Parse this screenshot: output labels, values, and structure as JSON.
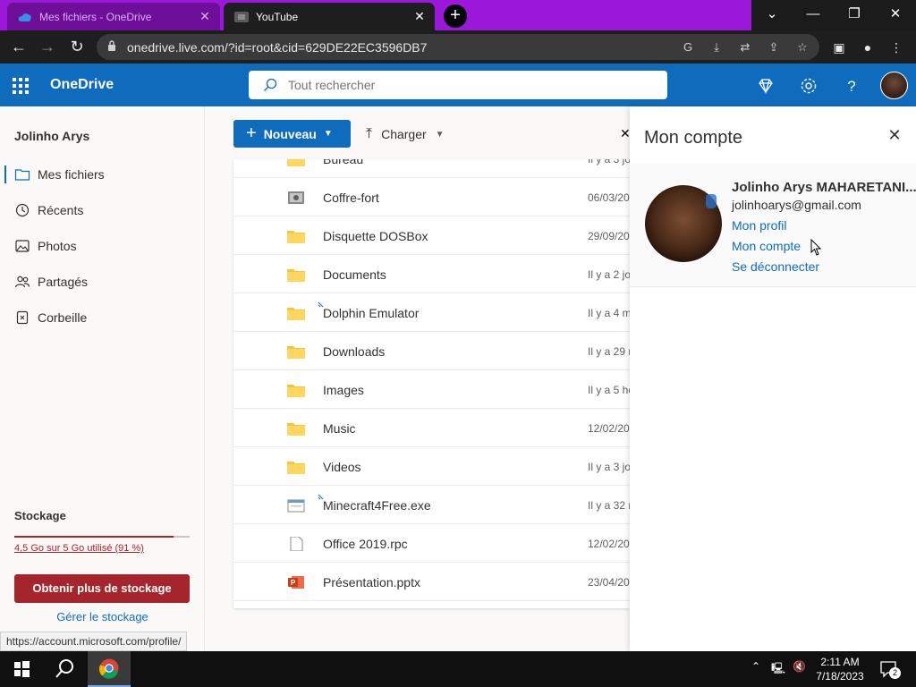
{
  "browser": {
    "tabs": [
      {
        "title": "Mes fichiers - OneDrive",
        "active": false
      },
      {
        "title": "YouTube",
        "active": true
      }
    ],
    "new_tab": "+",
    "url": "onedrive.live.com/?id=root&cid=629DE22EC3596DB7",
    "status_url": "https://account.microsoft.com/profile/"
  },
  "header": {
    "app_name": "OneDrive",
    "search_placeholder": "Tout rechercher"
  },
  "sidebar": {
    "user_name": "Jolinho Arys",
    "items": [
      {
        "label": "Mes fichiers",
        "icon": "folder-icon",
        "active": true
      },
      {
        "label": "Récents",
        "icon": "history-icon"
      },
      {
        "label": "Photos",
        "icon": "image-icon"
      },
      {
        "label": "Partagés",
        "icon": "people-icon"
      },
      {
        "label": "Corbeille",
        "icon": "trash-icon"
      }
    ],
    "storage": {
      "title": "Stockage",
      "usage_text": "4,5 Go sur 5 Go utilisé (91 %)",
      "usage_fraction": 0.91,
      "buy_button": "Obtenir plus de stockage",
      "manage_link": "Gérer le stockage"
    }
  },
  "commandbar": {
    "new_label": "Nouveau",
    "upload_label": "Charger"
  },
  "files": [
    {
      "name": "Bureau",
      "type": "folder",
      "modified": "Il y a 3 jo"
    },
    {
      "name": "Coffre-fort",
      "type": "vault",
      "modified": "06/03/20"
    },
    {
      "name": "Disquette DOSBox",
      "type": "folder",
      "modified": "29/09/20"
    },
    {
      "name": "Documents",
      "type": "folder",
      "modified": "Il y a 2 jo"
    },
    {
      "name": "Dolphin Emulator",
      "type": "folder",
      "modified": "Il y a 4 m",
      "syncing": true
    },
    {
      "name": "Downloads",
      "type": "folder",
      "modified": "Il y a 29 r"
    },
    {
      "name": "Images",
      "type": "folder",
      "modified": "Il y a 5 he"
    },
    {
      "name": "Music",
      "type": "folder",
      "modified": "12/02/20"
    },
    {
      "name": "Videos",
      "type": "folder",
      "modified": "Il y a 3 jo"
    },
    {
      "name": "Minecraft4Free.exe",
      "type": "exe",
      "modified": "Il y a 32 r",
      "syncing": true
    },
    {
      "name": "Office 2019.rpc",
      "type": "file",
      "modified": "12/02/20"
    },
    {
      "name": "Présentation.pptx",
      "type": "pptx",
      "modified": "23/04/20"
    }
  ],
  "account_panel": {
    "title": "Mon compte",
    "full_name": "Jolinho Arys MAHARETANI...",
    "email": "jolinhoarys@gmail.com",
    "links": [
      "Mon profil",
      "Mon compte",
      "Se déconnecter"
    ]
  },
  "taskbar": {
    "time": "2:11 AM",
    "date": "7/18/2023",
    "notifications": "2"
  },
  "colors": {
    "brand": "#0f6cbd",
    "tab_strip": "#9b17d9",
    "storage_warning": "#a4262c"
  }
}
